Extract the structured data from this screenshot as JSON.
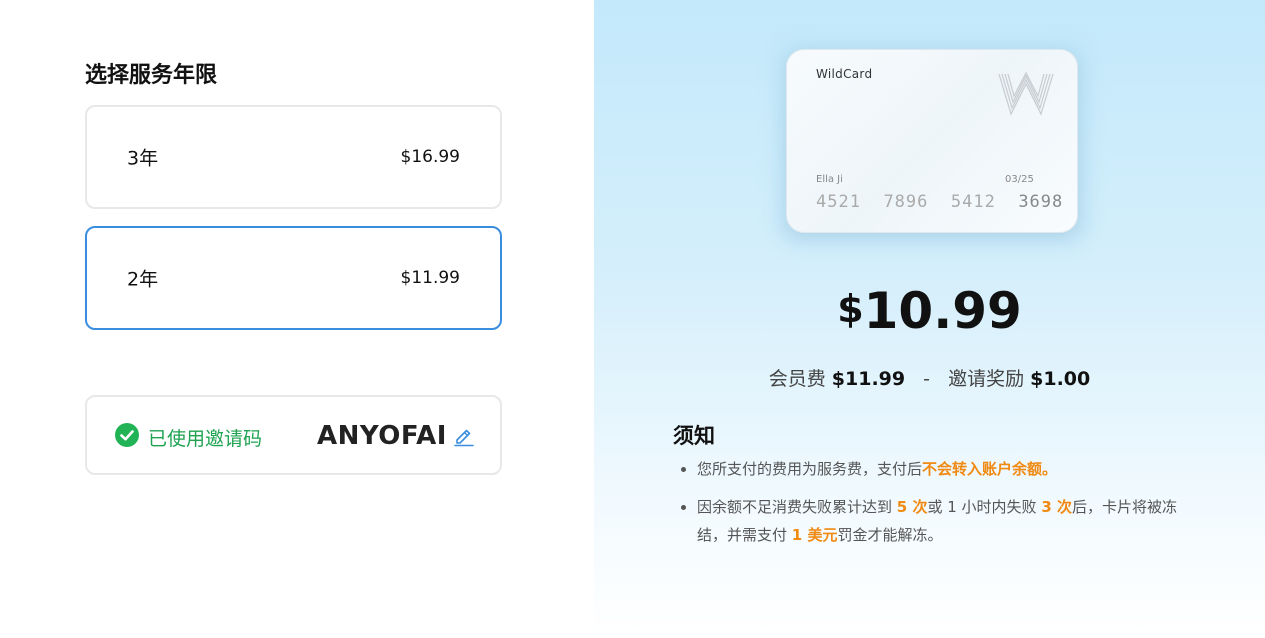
{
  "plans": {
    "title": "选择服务年限",
    "items": [
      {
        "label": "3年",
        "price": "$16.99",
        "selected": false
      },
      {
        "label": "2年",
        "price": "$11.99",
        "selected": true
      }
    ]
  },
  "invite": {
    "status": "已使用邀请码",
    "code": "ANYOFAI"
  },
  "card": {
    "brand": "WildCard",
    "holder": "Ella Ji",
    "expiry": "03/25",
    "number": [
      "4521",
      "7896",
      "5412",
      "3698"
    ]
  },
  "summary": {
    "currency": "$",
    "amount": "10.99",
    "fee_label": "会员费",
    "fee_value": "$11.99",
    "separator": "-",
    "reward_label": "邀请奖励",
    "reward_value": "$1.00"
  },
  "notice": {
    "title": "须知",
    "item1_text": "您所支付的费用为服务费，支付后",
    "item1_highlight": "不会转入账户余额。",
    "item2_a": "因余额不足消费失败累计达到 ",
    "item2_h1": "5 次",
    "item2_b": "或 1 小时内失败 ",
    "item2_h2": "3 次",
    "item2_c": "后，卡片将被冻结，并需支付 ",
    "item2_h3": "1 美元",
    "item2_d": "罚金才能解冻。"
  },
  "colors": {
    "accent": "#3a8ee0",
    "success": "#22b357",
    "highlight": "#f08a12"
  },
  "icons": [
    "check-circle-icon",
    "edit-pencil-icon",
    "wildcard-logo"
  ]
}
